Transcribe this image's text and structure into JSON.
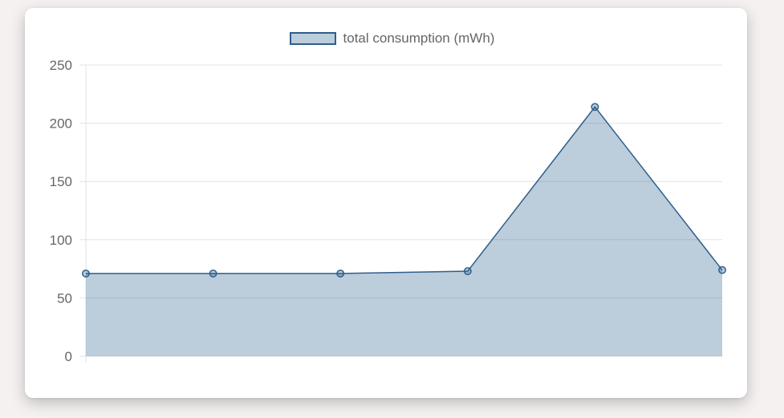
{
  "chart_data": {
    "type": "area",
    "legend": {
      "position": "top",
      "entries": [
        "total consumption (mWh)"
      ]
    },
    "series": [
      {
        "name": "total consumption (mWh)",
        "x": [
          0,
          1,
          2,
          3,
          4,
          5
        ],
        "values": [
          71,
          71,
          71,
          73,
          214,
          74
        ]
      }
    ],
    "categories": [
      "",
      "",
      "",
      "",
      "",
      ""
    ],
    "ylim": [
      0,
      250
    ],
    "yticks": [
      "0",
      "50",
      "100",
      "150",
      "200",
      "250"
    ],
    "grid": true,
    "colors": {
      "line": "#2f5f8a",
      "fill": "rgba(33,88,138,0.3)",
      "grid": "#e3e3e3",
      "text": "#666666"
    }
  }
}
